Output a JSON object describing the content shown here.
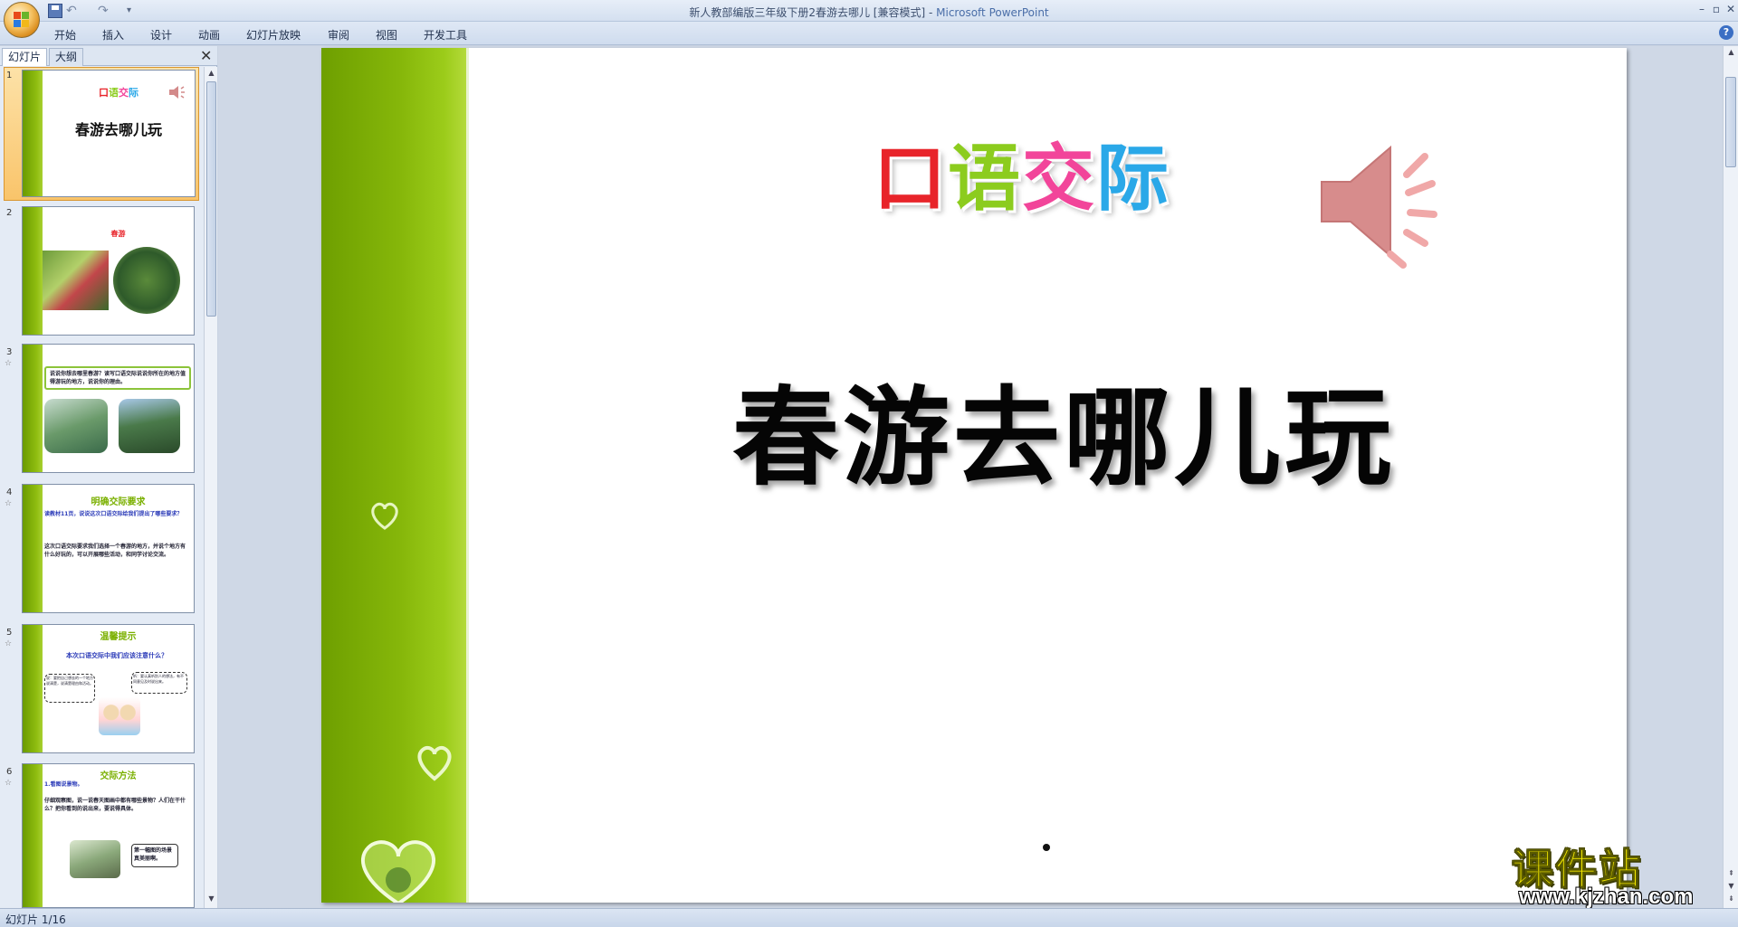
{
  "window": {
    "title": "新人教部编版三年级下册2春游去哪儿 [兼容模式] - ",
    "app_name": "Microsoft PowerPoint",
    "min_glyph": "–",
    "max_glyph": "▫",
    "close_glyph": "✕"
  },
  "quick_access": {
    "undo_glyph": "↶",
    "redo_glyph": "↷",
    "more_glyph": "▾"
  },
  "ribbon": {
    "tabs": [
      "开始",
      "插入",
      "设计",
      "动画",
      "幻灯片放映",
      "审阅",
      "视图",
      "开发工具"
    ],
    "help_glyph": "?"
  },
  "left_panel": {
    "tabs": [
      "幻灯片",
      "大纲"
    ],
    "close_glyph": "✕",
    "slide_numbers": [
      "1",
      "2",
      "3",
      "4",
      "5",
      "6"
    ],
    "star_glyph": "☆",
    "thumbs": {
      "s1": {
        "heading": "口语交际",
        "title": "春游去哪儿玩"
      },
      "s2": {
        "title": "春游"
      },
      "s3": {
        "text": "说说你想去哪里春游？读写口语交际说说你所在的地方值得游玩的地方，说说你的理由。"
      },
      "s4": {
        "title": "明确交际要求",
        "line1": "读教材11页，说说这次口语交际给我们提出了哪些要求？",
        "line2": "这次口语交际要求我们选择一个春游的地方，并说个地方有什么好玩的，可以开展哪些活动，和同学讨论交流。"
      },
      "s5": {
        "title": "温馨提示",
        "line1": "本次口语交际中我们应该注意什么？",
        "bubble_left": "说：要把自己想去的一个地方说清楚，说清楚理由和活动。",
        "bubble_right": "听：要认真听别人的想法，有不同意见及时说出来。"
      },
      "s6": {
        "title": "交际方法",
        "line1": "1.看图说景物。",
        "line2": "仔细观察图，说一说春天图画中都有哪些景物？人们在干什么？把你看到的说出来，要说得具体。",
        "bubble": "第一幅图的场景真美丽啊。"
      }
    }
  },
  "slide": {
    "heading_chars": [
      "口",
      "语",
      "交",
      "际"
    ],
    "heading_colors": [
      "#e8242a",
      "#8ccc1e",
      "#f2459a",
      "#2aa8e8"
    ],
    "title": "春游去哪儿玩",
    "accent_green": "#86b70a"
  },
  "watermark": {
    "cn": "课件站",
    "url": "www.kjzhan.com"
  },
  "status": {
    "slide_info": "幻灯片 1/16"
  }
}
